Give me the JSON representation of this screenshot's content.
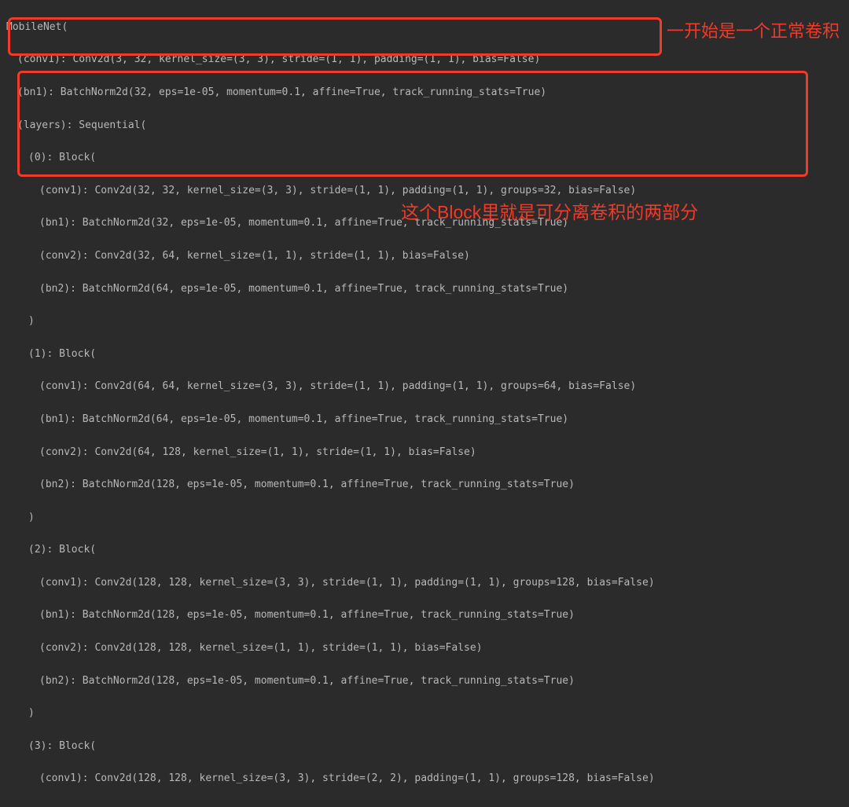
{
  "lines": {
    "l0": "MobileNet(",
    "l1": "(conv1): Conv2d(3, 32, kernel_size=(3, 3), stride=(1, 1), padding=(1, 1), bias=False)",
    "l2": "(bn1): BatchNorm2d(32, eps=1e-05, momentum=0.1, affine=True, track_running_stats=True)",
    "l3": "(layers): Sequential(",
    "l4": "(0): Block(",
    "l5": "(conv1): Conv2d(32, 32, kernel_size=(3, 3), stride=(1, 1), padding=(1, 1), groups=32, bias=False)",
    "l6": "(bn1): BatchNorm2d(32, eps=1e-05, momentum=0.1, affine=True, track_running_stats=True)",
    "l7": "(conv2): Conv2d(32, 64, kernel_size=(1, 1), stride=(1, 1), bias=False)",
    "l8": "(bn2): BatchNorm2d(64, eps=1e-05, momentum=0.1, affine=True, track_running_stats=True)",
    "l9": ")",
    "l10": "(1): Block(",
    "l11": "(conv1): Conv2d(64, 64, kernel_size=(3, 3), stride=(1, 1), padding=(1, 1), groups=64, bias=False)",
    "l12": "(bn1): BatchNorm2d(64, eps=1e-05, momentum=0.1, affine=True, track_running_stats=True)",
    "l13": "(conv2): Conv2d(64, 128, kernel_size=(1, 1), stride=(1, 1), bias=False)",
    "l14": "(bn2): BatchNorm2d(128, eps=1e-05, momentum=0.1, affine=True, track_running_stats=True)",
    "l15": ")",
    "l16": "(2): Block(",
    "l17": "(conv1): Conv2d(128, 128, kernel_size=(3, 3), stride=(1, 1), padding=(1, 1), groups=128, bias=False)",
    "l18": "(bn1): BatchNorm2d(128, eps=1e-05, momentum=0.1, affine=True, track_running_stats=True)",
    "l19": "(conv2): Conv2d(128, 128, kernel_size=(1, 1), stride=(1, 1), bias=False)",
    "l20": "(bn2): BatchNorm2d(128, eps=1e-05, momentum=0.1, affine=True, track_running_stats=True)",
    "l21": ")",
    "l22": "(3): Block(",
    "l23": "(conv1): Conv2d(128, 128, kernel_size=(3, 3), stride=(2, 2), padding=(1, 1), groups=128, bias=False)"
  },
  "annotations": {
    "a1": "一开始是一个正常卷积",
    "a2": "这个Block里就是可分离卷积的两部分"
  },
  "colors": {
    "bg": "#2b2b2b",
    "text": "#b8b8b8",
    "accent": "#f03a2a"
  }
}
